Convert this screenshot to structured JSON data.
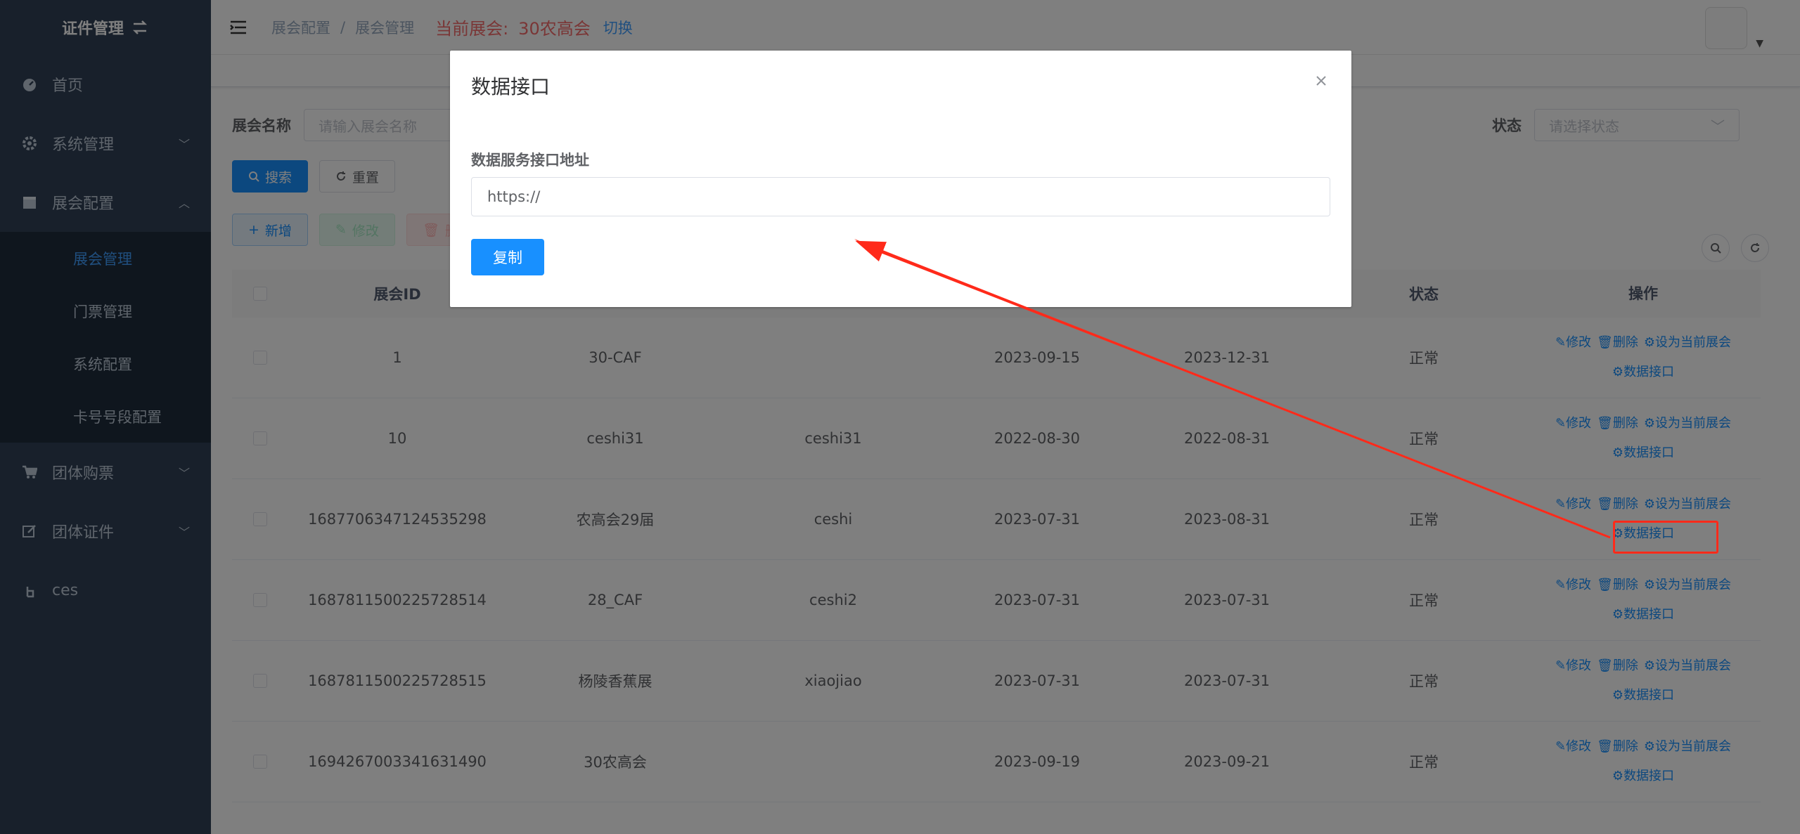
{
  "sidebar": {
    "title": "证件管理",
    "items": [
      {
        "label": "首页",
        "icon": "dashboard-icon"
      },
      {
        "label": "系统管理",
        "icon": "gear-icon"
      },
      {
        "label": "展会配置",
        "icon": "calendar-icon"
      }
    ],
    "subitems": [
      "展会管理",
      "门票管理",
      "系统配置",
      "卡号号段配置"
    ],
    "items2": [
      {
        "label": "团体购票",
        "icon": "cart-icon"
      },
      {
        "label": "团体证件",
        "icon": "edit-icon"
      },
      {
        "label": "ces",
        "icon": "hand-icon"
      }
    ]
  },
  "navbar": {
    "breadcrumb": [
      "展会配置",
      "展会管理"
    ],
    "current_label": "当前展会:",
    "current_name": "30农高会",
    "switch": "切换"
  },
  "search": {
    "name_label": "展会名称",
    "name_placeholder": "请输入展会名称",
    "status_label": "状态",
    "status_placeholder": "请选择状态",
    "search_btn": "搜索",
    "reset_btn": "重置"
  },
  "toolbar": {
    "add": "新增",
    "edit": "修改",
    "delete": "删"
  },
  "table": {
    "headers": {
      "id": "展会ID",
      "status": "状态",
      "ops": "操作"
    },
    "op_labels": {
      "edit": "修改",
      "delete": "删除",
      "set_current": "设为当前展会",
      "data_api": "数据接口"
    },
    "rows": [
      {
        "id": "1",
        "name": "30-CAF",
        "code": "",
        "start": "2023-09-15",
        "end": "2023-12-31",
        "status": "正常"
      },
      {
        "id": "10",
        "name": "ceshi31",
        "code": "ceshi31",
        "start": "2022-08-30",
        "end": "2022-08-31",
        "status": "正常"
      },
      {
        "id": "1687706347124535298",
        "name": "农高会29届",
        "code": "ceshi",
        "start": "2023-07-31",
        "end": "2023-08-31",
        "status": "正常"
      },
      {
        "id": "1687811500225728514",
        "name": "28_CAF",
        "code": "ceshi2",
        "start": "2023-07-31",
        "end": "2023-07-31",
        "status": "正常"
      },
      {
        "id": "1687811500225728515",
        "name": "杨陵香蕉展",
        "code": "xiaojiao",
        "start": "2023-07-31",
        "end": "2023-07-31",
        "status": "正常"
      },
      {
        "id": "1694267003341631490",
        "name": "30农高会",
        "code": "",
        "start": "2023-09-19",
        "end": "2023-09-21",
        "status": "正常"
      }
    ]
  },
  "dialog": {
    "title": "数据接口",
    "label": "数据服务接口地址",
    "value": "https://",
    "copy_btn": "复制"
  },
  "colors": {
    "sidebar_bg": "#304156",
    "primary": "#1890ff",
    "danger": "#f56c6c",
    "annotation": "#ff2a1a"
  }
}
